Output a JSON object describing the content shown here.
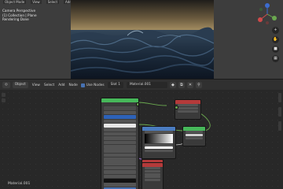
{
  "viewport": {
    "menu": [
      "Object Mode",
      "View",
      "Select",
      "Add",
      "Object"
    ],
    "info": {
      "line1": "Camera Perspective",
      "line2": "(1) Collection | Plane",
      "line3": "Rendering Done"
    },
    "gizmo": {
      "axes": [
        "Z",
        "Y",
        "X"
      ]
    },
    "tools": [
      "magnify-icon",
      "hand-icon",
      "camera-icon",
      "grid-icon"
    ]
  },
  "node_editor": {
    "header": {
      "editor_type": "◎",
      "mode": "Object",
      "menus": [
        "View",
        "Select",
        "Add",
        "Node"
      ],
      "use_nodes_label": "Use Nodes",
      "slot": "Slot 1",
      "material": "Material.001"
    },
    "material_label": "Material.001",
    "nodes": [
      {
        "name": "principled-bsdf-node",
        "header_color": "#47b85a"
      },
      {
        "name": "material-output-node",
        "header_color": "#b43a3a"
      },
      {
        "name": "color-ramp-node",
        "header_color": "#4b7cc0"
      },
      {
        "name": "mix-shader-node",
        "header_color": "#47b85a"
      },
      {
        "name": "noise-texture-node",
        "header_color": "#b43a3a"
      },
      {
        "name": "small-input-node",
        "header_color": "#b43a3a"
      }
    ]
  },
  "colors": {
    "shader_header": "#47b85a",
    "output_header": "#b43a3a",
    "converter_header": "#4b7cc0",
    "accent": "#4772b3"
  }
}
